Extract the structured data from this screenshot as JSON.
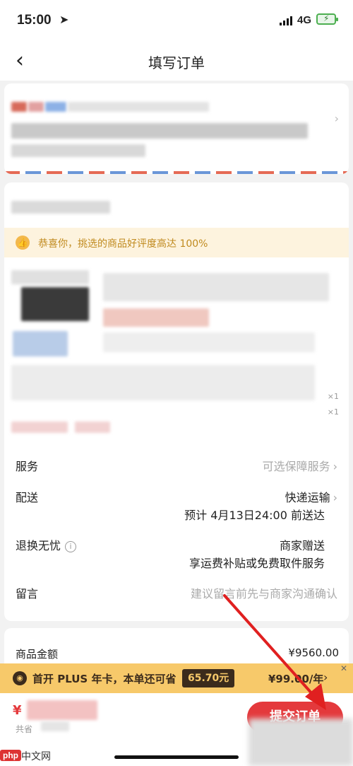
{
  "status_bar": {
    "time": "15:00",
    "network": "4G"
  },
  "nav": {
    "title": "填写订单"
  },
  "notice": {
    "text": "恭喜你，挑选的商品好评度高达 100%"
  },
  "product": {
    "qty_1": "×1",
    "qty_2": "×1"
  },
  "rows": {
    "service": {
      "label": "服务",
      "value": "可选保障服务"
    },
    "delivery": {
      "label": "配送",
      "value": "快递运输",
      "sub": "预计 4月13日24:00 前送达"
    },
    "return": {
      "label": "退换无忧",
      "value": "商家赠送",
      "sub": "享运费补贴或免费取件服务"
    },
    "message": {
      "label": "留言",
      "placeholder": "建议留言前先与商家沟通确认"
    }
  },
  "amount": {
    "label": "商品金额",
    "value": "¥9560.00"
  },
  "plus": {
    "text": "首开 PLUS 年卡，本单还可省",
    "save": "65.70元",
    "price": "¥99.00/年"
  },
  "bottom": {
    "currency": "¥",
    "sub": "共省",
    "submit": "提交订单"
  },
  "watermark": {
    "logo": "php",
    "text": "中文网"
  },
  "colors": {
    "accent": "#e4393c",
    "notice_bg": "#fdf3de",
    "plus_bg": "#f7c96a"
  }
}
